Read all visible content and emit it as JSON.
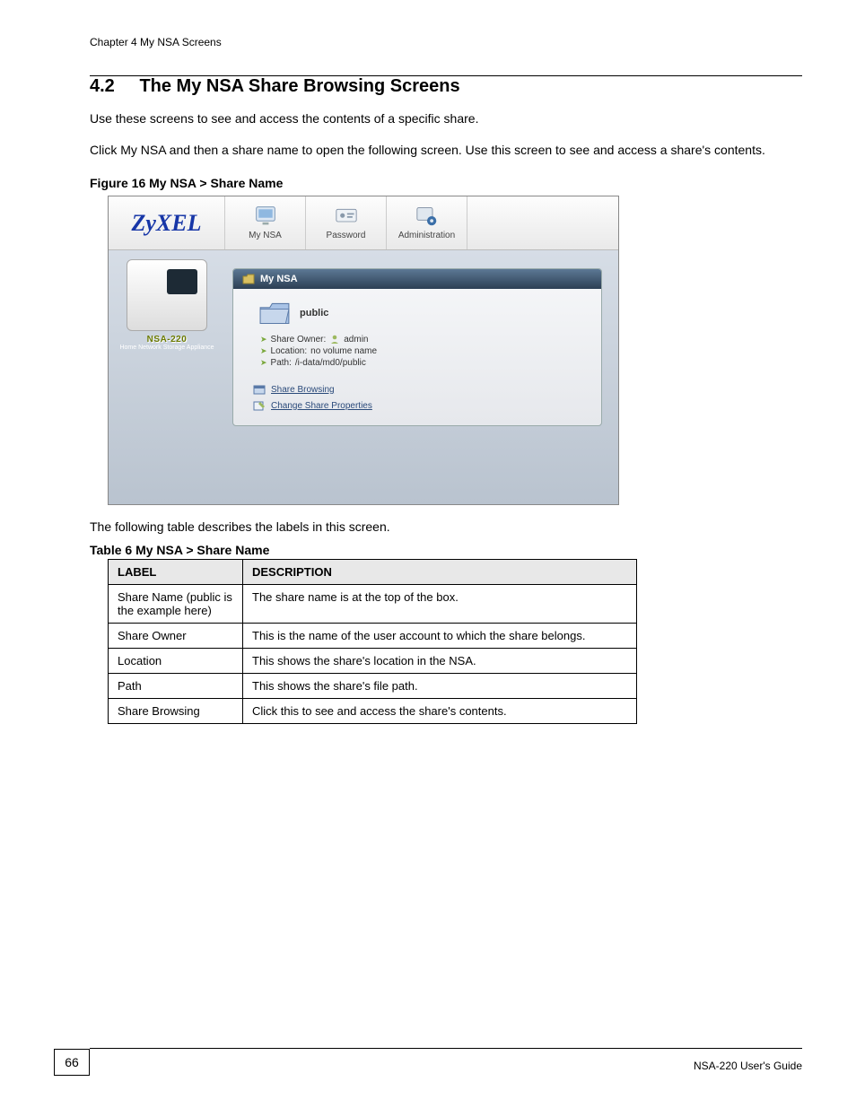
{
  "header": {
    "chapter": "Chapter 4 My NSA Screens"
  },
  "section": {
    "number": "4.2",
    "title": "The My NSA Share Browsing Screens",
    "intro1": "Use these screens to see and access the contents of a specific share.",
    "intro2": "Click My NSA and then a share name to open the following screen. Use this screen to see and access a share's contents."
  },
  "figure": {
    "caption": "Figure 16   My NSA > Share Name"
  },
  "screenshot": {
    "logo": "ZyXEL",
    "tabs": {
      "my_nsa": "My NSA",
      "password": "Password",
      "administration": "Administration"
    },
    "side": {
      "model": "NSA-220",
      "tagline": "Home Network Storage Appliance"
    },
    "panel": {
      "title": "My NSA",
      "share_name": "public",
      "owner_label": "Share Owner:",
      "owner_value": "admin",
      "location_label": "Location:",
      "location_value": "no volume name",
      "path_label": "Path:",
      "path_value": "/i-data/md0/public",
      "link_browse": "Share Browsing",
      "link_props": "Change Share Properties"
    }
  },
  "table": {
    "intro": "The following table describes the labels in this screen.",
    "caption": "Table 6   My NSA > Share Name",
    "header": {
      "label": "LABEL",
      "desc": "DESCRIPTION"
    },
    "rows": [
      {
        "label": "Share Name (public is the example here)",
        "desc": "The share name is at the top of the box."
      },
      {
        "label": "Share Owner",
        "desc": "This is the name of the user account to which the share belongs."
      },
      {
        "label": "Location",
        "desc": "This shows the share's location in the NSA."
      },
      {
        "label": "Path",
        "desc": "This shows the share's file path."
      },
      {
        "label": "Share Browsing",
        "desc": "Click this to see and access the share's contents."
      }
    ]
  },
  "footer": {
    "page": "66",
    "guide": "NSA-220 User's Guide"
  }
}
